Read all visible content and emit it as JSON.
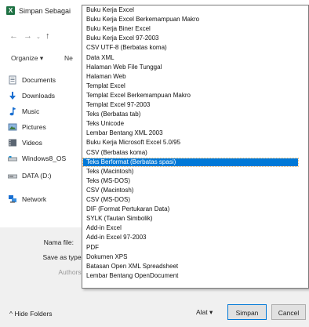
{
  "window": {
    "title": "Simpan Sebagai",
    "app_icon_letter": "X"
  },
  "nav": {
    "back_icon": "arrow-left-icon",
    "forward_icon": "arrow-right-icon",
    "dropdown_icon": "chevron-down-icon",
    "up_icon": "arrow-up-icon"
  },
  "commandbar": {
    "organize": "Organize ▾",
    "new_folder": "Ne"
  },
  "sidebar": {
    "items": [
      {
        "label": "Documents",
        "icon": "documents-icon"
      },
      {
        "label": "Downloads",
        "icon": "downloads-icon"
      },
      {
        "label": "Music",
        "icon": "music-icon"
      },
      {
        "label": "Pictures",
        "icon": "pictures-icon"
      },
      {
        "label": "Videos",
        "icon": "videos-icon"
      },
      {
        "label": "Windows8_OS",
        "icon": "drive-icon"
      },
      {
        "label": "DATA (D:)",
        "icon": "drive-icon"
      },
      {
        "label": "Network",
        "icon": "network-icon"
      }
    ]
  },
  "form": {
    "filename_label": "Nama file:",
    "savetype_label": "Save as type:",
    "authors_label": "Authors:"
  },
  "footer": {
    "hide_folders": "Hide Folders",
    "tools": "Alat",
    "save": "Simpan",
    "cancel": "Cancel"
  },
  "file_types": {
    "selected_index": 16,
    "options": [
      "Buku Kerja Excel",
      "Buku Kerja Excel Berkemampuan Makro",
      "Buku Kerja Biner Excel",
      "Buku Kerja Excel 97-2003",
      "CSV UTF-8 (Berbatas koma)",
      "Data XML",
      "Halaman Web File Tunggal",
      "Halaman Web",
      "Templat Excel",
      "Templat Excel Berkemampuan Makro",
      "Templat Excel 97-2003",
      "Teks (Berbatas tab)",
      "Teks Unicode",
      "Lembar Bentang XML 2003",
      "Buku Kerja Microsoft Excel 5.0/95",
      "CSV (Berbatas koma)",
      "Teks Berformat (Berbatas spasi)",
      "Teks (Macintosh)",
      "Teks (MS-DOS)",
      "CSV (Macintosh)",
      "CSV (MS-DOS)",
      "DIF (Format Pertukaran Data)",
      "SYLK (Tautan Simbolik)",
      "Add-in Excel",
      "Add-in Excel 97-2003",
      "PDF",
      "Dokumen XPS",
      "Batasan Open XML Spreadsheet",
      "Lembar Bentang OpenDocument"
    ]
  },
  "colors": {
    "selection": "#0078d7",
    "excel_green": "#1f7244"
  }
}
